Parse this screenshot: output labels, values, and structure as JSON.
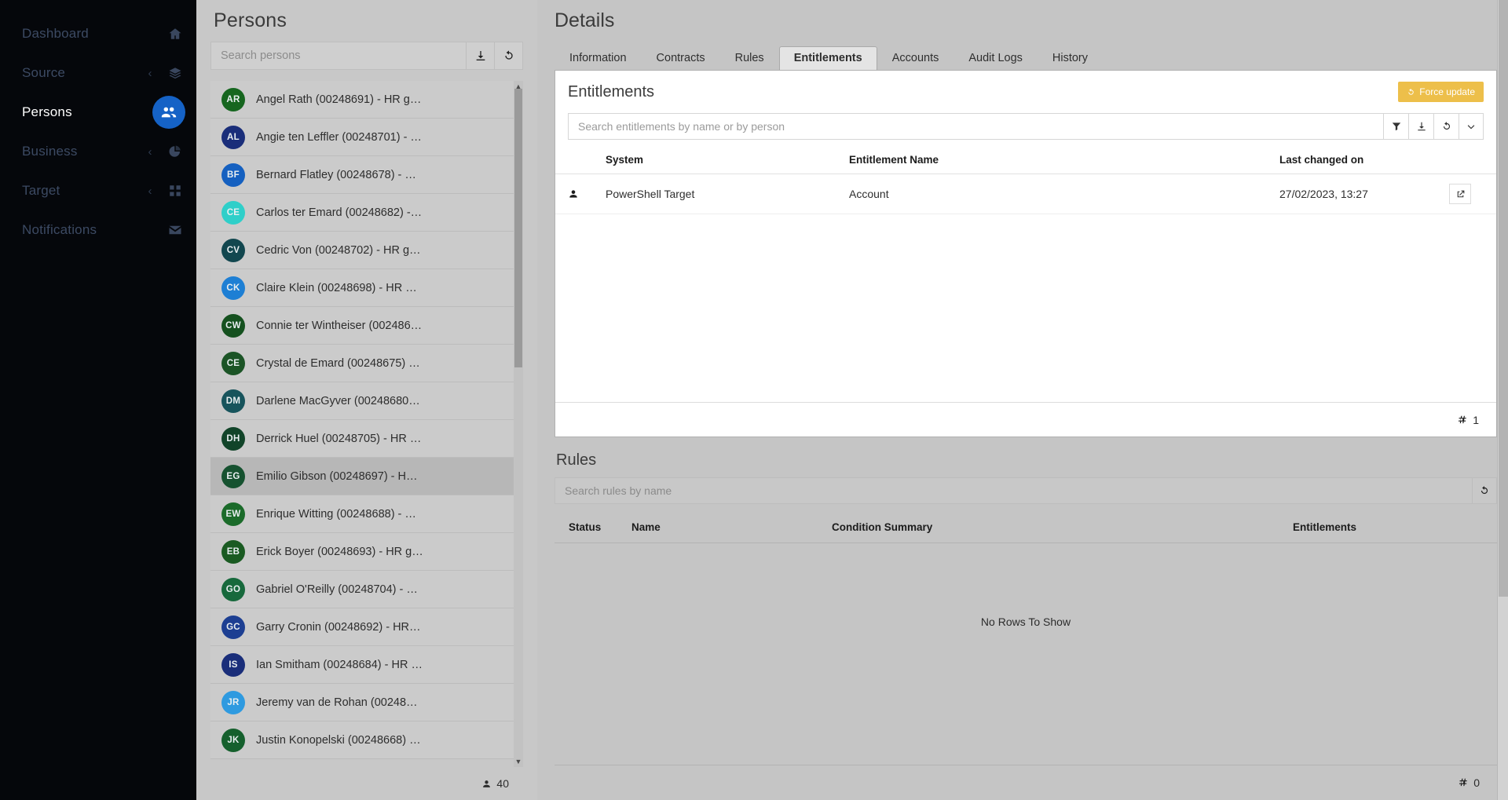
{
  "sidebar": {
    "items": [
      {
        "label": "Dashboard",
        "icon": "home-icon",
        "caret": false,
        "active": false
      },
      {
        "label": "Source",
        "icon": "layers-icon",
        "caret": true,
        "active": false
      },
      {
        "label": "Persons",
        "icon": "people-icon",
        "caret": false,
        "active": true
      },
      {
        "label": "Business",
        "icon": "pie-chart-icon",
        "caret": true,
        "active": false
      },
      {
        "label": "Target",
        "icon": "grid-icon",
        "caret": true,
        "active": false
      },
      {
        "label": "Notifications",
        "icon": "envelope-icon",
        "caret": false,
        "active": false
      }
    ],
    "caret_glyph": "‹",
    "active_color": "#1562c6"
  },
  "persons": {
    "title": "Persons",
    "search": {
      "value": "",
      "placeholder": "Search persons"
    },
    "download_icon": "download-icon",
    "refresh_icon": "refresh-icon",
    "count_label": "40",
    "count_icon": "person-icon",
    "rows": [
      {
        "initials": "AR",
        "color": "#16661f",
        "label": "Angel Rath (00248691) - HR g…",
        "selected": false
      },
      {
        "initials": "AL",
        "color": "#1a2e7a",
        "label": "Angie ten Leffler (00248701) - …",
        "selected": false
      },
      {
        "initials": "BF",
        "color": "#1560c0",
        "label": "Bernard Flatley (00248678) - …",
        "selected": false
      },
      {
        "initials": "CE",
        "color": "#2fcfc9",
        "label": "Carlos ter Emard (00248682) -…",
        "selected": false
      },
      {
        "initials": "CV",
        "color": "#12474f",
        "label": "Cedric Von (00248702) - HR g…",
        "selected": false
      },
      {
        "initials": "CK",
        "color": "#1e7fd4",
        "label": "Claire Klein (00248698) - HR …",
        "selected": false
      },
      {
        "initials": "CW",
        "color": "#15511f",
        "label": "Connie ter Wintheiser (002486…",
        "selected": false
      },
      {
        "initials": "CE",
        "color": "#1b5426",
        "label": "Crystal de Emard (00248675) …",
        "selected": false
      },
      {
        "initials": "DM",
        "color": "#17545c",
        "label": "Darlene MacGyver (00248680…",
        "selected": false
      },
      {
        "initials": "DH",
        "color": "#114429",
        "label": "Derrick Huel (00248705) - HR …",
        "selected": false
      },
      {
        "initials": "EG",
        "color": "#165230",
        "label": "Emilio Gibson (00248697) - H…",
        "selected": true
      },
      {
        "initials": "EW",
        "color": "#1b6b2a",
        "label": "Enrique Witting (00248688) - …",
        "selected": false
      },
      {
        "initials": "EB",
        "color": "#1a5b22",
        "label": "Erick Boyer (00248693) - HR g…",
        "selected": false
      },
      {
        "initials": "GO",
        "color": "#17693c",
        "label": "Gabriel O'Reilly (00248704) - …",
        "selected": false
      },
      {
        "initials": "GC",
        "color": "#1d3f92",
        "label": "Garry Cronin (00248692) - HR…",
        "selected": false
      },
      {
        "initials": "IS",
        "color": "#1a2e7a",
        "label": "Ian Smitham (00248684) - HR …",
        "selected": false
      },
      {
        "initials": "JR",
        "color": "#2e9ae0",
        "label": "Jeremy van de Rohan (00248…",
        "selected": false
      },
      {
        "initials": "JK",
        "color": "#15602d",
        "label": "Justin Konopelski (00248668) …",
        "selected": false
      }
    ]
  },
  "details": {
    "title": "Details",
    "tabs": [
      {
        "label": "Information",
        "active": false
      },
      {
        "label": "Contracts",
        "active": false
      },
      {
        "label": "Rules",
        "active": false
      },
      {
        "label": "Entitlements",
        "active": true
      },
      {
        "label": "Accounts",
        "active": false
      },
      {
        "label": "Audit Logs",
        "active": false
      },
      {
        "label": "History",
        "active": false
      }
    ]
  },
  "entitlements": {
    "title": "Entitlements",
    "force_update_label": "Force update",
    "force_update_icon": "refresh-icon",
    "force_update_color": "#edbf4a",
    "search": {
      "value": "",
      "placeholder": "Search entitlements by name or by person"
    },
    "toolbar_icons": [
      "filter-icon",
      "download-icon",
      "refresh-icon",
      "chevron-down-icon"
    ],
    "columns": [
      "System",
      "Entitlement Name",
      "Last changed on"
    ],
    "rows": [
      {
        "row_icon": "person-icon",
        "system": "PowerShell Target",
        "entitlement_name": "Account",
        "last_changed_on": "27/02/2023, 13:27",
        "action_icon": "external-link-icon"
      }
    ],
    "count_label": "1",
    "count_icon": "hash-icon"
  },
  "rules": {
    "title": "Rules",
    "search": {
      "value": "",
      "placeholder": "Search rules by name"
    },
    "refresh_icon": "refresh-icon",
    "columns": [
      "Status",
      "Name",
      "Condition Summary",
      "Entitlements"
    ],
    "empty_message": "No Rows To Show",
    "count_label": "0",
    "count_icon": "hash-icon"
  }
}
